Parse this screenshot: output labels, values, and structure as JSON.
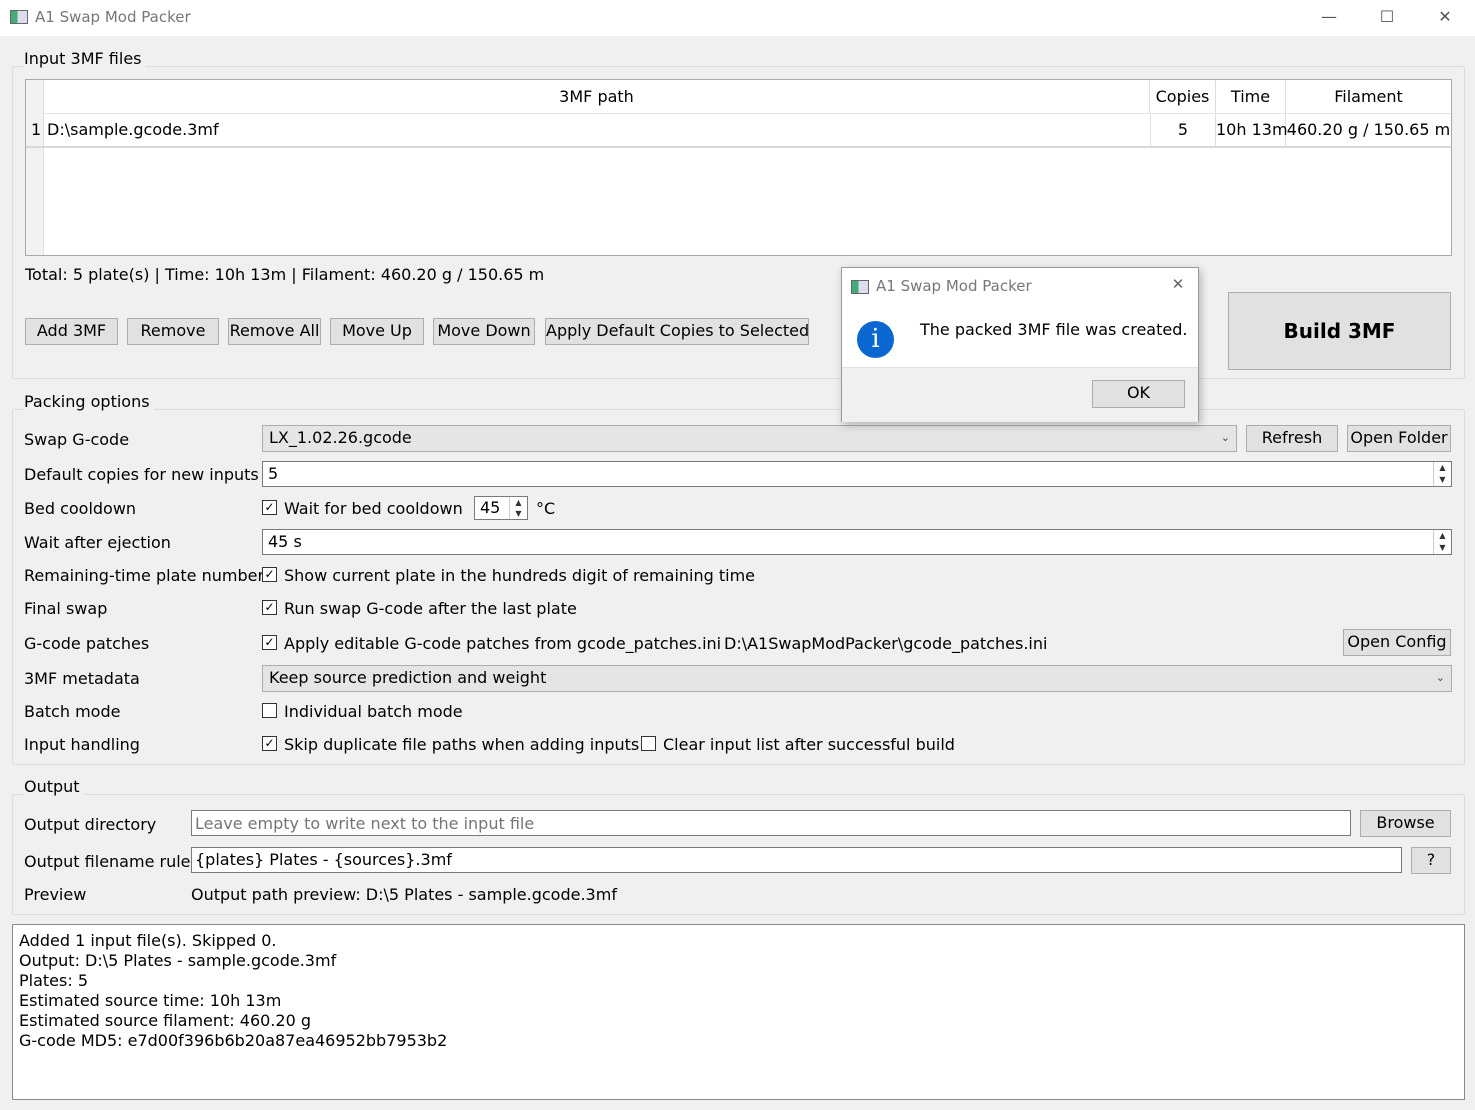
{
  "window": {
    "title": "A1 Swap Mod Packer",
    "minimize": "—",
    "maximize": "☐",
    "close": "✕"
  },
  "inputs": {
    "group_title": "Input 3MF files",
    "columns": {
      "path": "3MF path",
      "copies": "Copies",
      "time": "Time",
      "filament": "Filament"
    },
    "rows": [
      {
        "index": "1",
        "path": "D:\\sample.gcode.3mf",
        "copies": "5",
        "time": "10h 13m",
        "filament": "460.20 g / 150.65 m"
      }
    ],
    "total": "Total: 5 plate(s) | Time: 10h 13m | Filament: 460.20 g / 150.65 m",
    "buttons": {
      "add": "Add 3MF",
      "remove": "Remove",
      "remove_all": "Remove All",
      "move_up": "Move Up",
      "move_down": "Move Down",
      "apply_default": "Apply Default Copies to Selected"
    }
  },
  "build_button": "Build 3MF",
  "packing": {
    "group_title": "Packing options",
    "swap_gcode": {
      "label": "Swap G-code",
      "value": "LX_1.02.26.gcode",
      "refresh": "Refresh",
      "open_folder": "Open Folder"
    },
    "default_copies": {
      "label": "Default copies for new inputs",
      "value": "5"
    },
    "bed_cooldown": {
      "label": "Bed cooldown",
      "checkbox": "Wait for bed cooldown",
      "checked": true,
      "temp": "45",
      "unit": "°C"
    },
    "wait_after_ejection": {
      "label": "Wait after ejection",
      "value": "45 s"
    },
    "remaining_time": {
      "label": "Remaining-time plate number",
      "checkbox": "Show current plate in the hundreds digit of remaining time",
      "checked": true
    },
    "final_swap": {
      "label": "Final swap",
      "checkbox": "Run swap G-code after the last plate",
      "checked": true
    },
    "gcode_patches": {
      "label": "G-code patches",
      "checkbox": "Apply editable G-code patches from gcode_patches.ini",
      "checked": true,
      "path": "D:\\A1SwapModPacker\\gcode_patches.ini",
      "open_config": "Open Config"
    },
    "metadata": {
      "label": "3MF metadata",
      "value": "Keep source prediction and weight"
    },
    "batch_mode": {
      "label": "Batch mode",
      "checkbox": "Individual batch mode",
      "checked": false
    },
    "input_handling": {
      "label": "Input handling",
      "checkbox1": "Skip duplicate file paths when adding inputs",
      "checked1": true,
      "checkbox2": "Clear input list after successful build",
      "checked2": false
    }
  },
  "output": {
    "group_title": "Output",
    "directory": {
      "label": "Output directory",
      "placeholder": "Leave empty to write next to the input file",
      "browse": "Browse"
    },
    "filename_rule": {
      "label": "Output filename rule",
      "value": "{plates} Plates - {sources}.3mf",
      "help": "?"
    },
    "preview": {
      "label": "Preview",
      "value": "Output path preview: D:\\5 Plates - sample.gcode.3mf"
    }
  },
  "log": [
    "Added 1 input file(s). Skipped 0.",
    "Output: D:\\5 Plates - sample.gcode.3mf",
    "Plates: 5",
    "Estimated source time: 10h 13m",
    "Estimated source filament: 460.20 g",
    "G-code MD5: e7d00f396b6b20a87ea46952bb7953b2"
  ],
  "dialog": {
    "title": "A1 Swap Mod Packer",
    "message": "The packed 3MF file was created.",
    "ok": "OK",
    "close": "✕",
    "icon": "info-icon",
    "accent": "#0a66d0"
  }
}
